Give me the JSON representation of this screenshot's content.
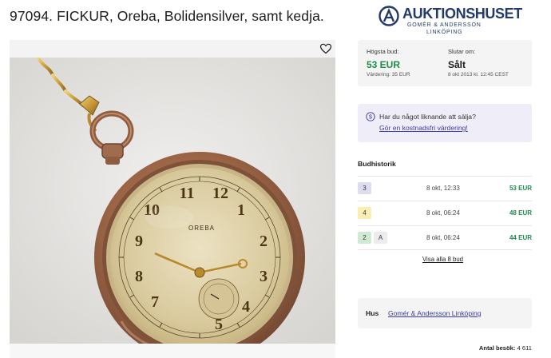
{
  "lot": {
    "title": "97094. FICKUR, Oreba, Bolidensilver, samt kedja."
  },
  "logo": {
    "name": "AUKTIONSHUSET",
    "sub": "GOMÉR & ANDERSSON",
    "city": "LINKÖPING"
  },
  "image": {
    "dial_brand": "OREBA",
    "alt_icon": "favorite-heart-icon"
  },
  "bid": {
    "highest_label": "Högsta bud:",
    "highest_value": "53 EUR",
    "valuation": "Värdering: 35 EUR",
    "ends_label": "Slutar om:",
    "ends_value": "Sålt",
    "ends_date": "8 okt 2013 kl. 12:45 CEST"
  },
  "sell": {
    "question": "Har du något liknande att sälja?",
    "link": "Gör en kostnadsfri värdering!"
  },
  "bid_history": {
    "title": "Budhistorik",
    "rows": [
      {
        "bidder": "3",
        "extra": "",
        "time": "8 okt, 12:33",
        "amount": "53 EUR"
      },
      {
        "bidder": "4",
        "extra": "",
        "time": "8 okt, 06:24",
        "amount": "48 EUR"
      },
      {
        "bidder": "2",
        "extra": "A",
        "time": "8 okt, 06:24",
        "amount": "44 EUR"
      }
    ],
    "see_all": "Visa alla 8 bud"
  },
  "house": {
    "label": "Hus",
    "name": "Gomér & Andersson Linköping"
  },
  "visits": {
    "label": "Antal besök:",
    "count": "4 611"
  },
  "colors": {
    "brand": "#233a6b",
    "green": "#1f8c4c",
    "link": "#3a3aa8"
  }
}
